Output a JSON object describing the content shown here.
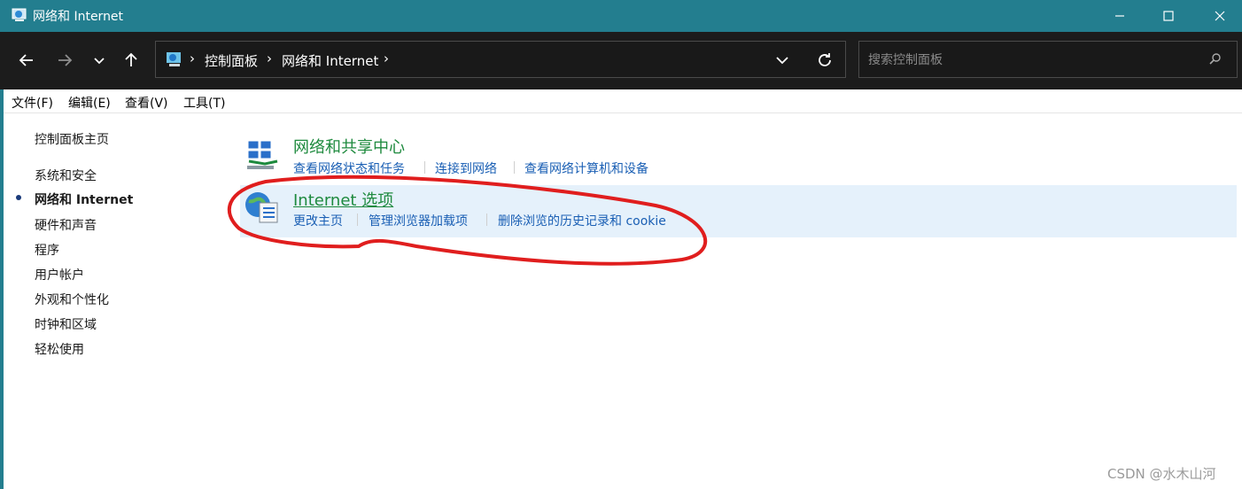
{
  "window": {
    "title": "网络和 Internet",
    "minimize_icon": "minimize-icon",
    "maximize_icon": "maximize-icon",
    "close_icon": "close-icon"
  },
  "navigation": {
    "back_icon": "arrow-left-icon",
    "forward_icon": "arrow-right-icon",
    "recent_icon": "chevron-down-icon",
    "up_icon": "arrow-up-icon"
  },
  "address_bar": {
    "breadcrumbs": [
      "控制面板",
      "网络和 Internet"
    ],
    "separator": "›"
  },
  "search": {
    "placeholder": "搜索控制面板"
  },
  "menu": {
    "items": [
      "文件(F)",
      "编辑(E)",
      "查看(V)",
      "工具(T)"
    ]
  },
  "sidebar": {
    "home": "控制面板主页",
    "items": [
      "系统和安全",
      "网络和 Internet",
      "硬件和声音",
      "程序",
      "用户帐户",
      "外观和个性化",
      "时钟和区域",
      "轻松使用"
    ],
    "active_index": 1
  },
  "categories": [
    {
      "title": "网络和共享中心",
      "icon": "network-icon",
      "links": [
        "查看网络状态和任务",
        "连接到网络",
        "查看网络计算机和设备"
      ]
    },
    {
      "title": "Internet 选项",
      "icon": "internet-options-icon",
      "links": [
        "更改主页",
        "管理浏览器加载项",
        "删除浏览的历史记录和 cookie"
      ]
    }
  ],
  "colors": {
    "titlebar": "#237e8f",
    "navbar": "#1c1c1c",
    "category_title": "#1e8a3e",
    "link": "#1a5fb4",
    "highlight": "#e5f1fb",
    "annotation": "#e01e1e"
  },
  "watermark": "CSDN @水木山河"
}
